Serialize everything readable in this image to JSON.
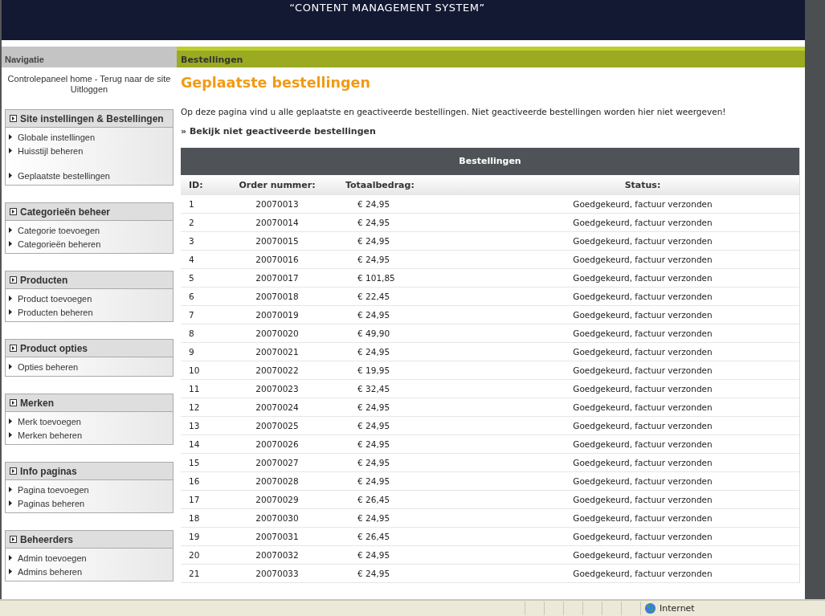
{
  "header": {
    "title": "“CONTENT MANAGEMENT SYSTEM”"
  },
  "sidebar": {
    "title": "Navigatie",
    "links": [
      "Controlepaneel home - Terug naar de site",
      "Uitloggen"
    ],
    "sections": [
      {
        "title": "Site instellingen & Bestellingen",
        "item_groups": [
          [
            "Globale instellingen",
            "Huisstijl beheren"
          ],
          [
            "Geplaatste bestellingen"
          ]
        ]
      },
      {
        "title": "Categorieën beheer",
        "item_groups": [
          [
            "Categorie toevoegen",
            "Categorieën beheren"
          ]
        ]
      },
      {
        "title": "Producten",
        "item_groups": [
          [
            "Product toevoegen",
            "Producten beheren"
          ]
        ]
      },
      {
        "title": "Product opties",
        "item_groups": [
          [
            "Opties beheren"
          ]
        ]
      },
      {
        "title": "Merken",
        "item_groups": [
          [
            "Merk toevoegen",
            "Merken beheren"
          ]
        ]
      },
      {
        "title": "Info paginas",
        "item_groups": [
          [
            "Pagina toevoegen",
            "Paginas beheren"
          ]
        ]
      },
      {
        "title": "Beheerders",
        "item_groups": [
          [
            "Admin toevoegen",
            "Admins beheren"
          ]
        ]
      }
    ]
  },
  "content": {
    "section_title": "Bestellingen",
    "heading": "Geplaatste bestellingen",
    "intro": "Op deze pagina vind u alle geplaatste en geactiveerde bestellingen. Niet geactiveerde bestellingen worden hier niet weergeven!",
    "link": "» Bekijk niet geactiveerde bestellingen",
    "table": {
      "caption": "Bestellingen",
      "columns": [
        "ID:",
        "Order nummer:",
        "Totaalbedrag:",
        "Status:"
      ],
      "rows": [
        [
          "1",
          "20070013",
          "€ 24,95",
          "Goedgekeurd, factuur verzonden"
        ],
        [
          "2",
          "20070014",
          "€ 24,95",
          "Goedgekeurd, factuur verzonden"
        ],
        [
          "3",
          "20070015",
          "€ 24,95",
          "Goedgekeurd, factuur verzonden"
        ],
        [
          "4",
          "20070016",
          "€ 24,95",
          "Goedgekeurd, factuur verzonden"
        ],
        [
          "5",
          "20070017",
          "€ 101,85",
          "Goedgekeurd, factuur verzonden"
        ],
        [
          "6",
          "20070018",
          "€ 22,45",
          "Goedgekeurd, factuur verzonden"
        ],
        [
          "7",
          "20070019",
          "€ 24,95",
          "Goedgekeurd, factuur verzonden"
        ],
        [
          "8",
          "20070020",
          "€ 49,90",
          "Goedgekeurd, factuur verzonden"
        ],
        [
          "9",
          "20070021",
          "€ 24,95",
          "Goedgekeurd, factuur verzonden"
        ],
        [
          "10",
          "20070022",
          "€ 19,95",
          "Goedgekeurd, factuur verzonden"
        ],
        [
          "11",
          "20070023",
          "€ 32,45",
          "Goedgekeurd, factuur verzonden"
        ],
        [
          "12",
          "20070024",
          "€ 24,95",
          "Goedgekeurd, factuur verzonden"
        ],
        [
          "13",
          "20070025",
          "€ 24,95",
          "Goedgekeurd, factuur verzonden"
        ],
        [
          "14",
          "20070026",
          "€ 24,95",
          "Goedgekeurd, factuur verzonden"
        ],
        [
          "15",
          "20070027",
          "€ 24,95",
          "Goedgekeurd, factuur verzonden"
        ],
        [
          "16",
          "20070028",
          "€ 24,95",
          "Goedgekeurd, factuur verzonden"
        ],
        [
          "17",
          "20070029",
          "€ 26,45",
          "Goedgekeurd, factuur verzonden"
        ],
        [
          "18",
          "20070030",
          "€ 24,95",
          "Goedgekeurd, factuur verzonden"
        ],
        [
          "19",
          "20070031",
          "€ 26,45",
          "Goedgekeurd, factuur verzonden"
        ],
        [
          "20",
          "20070032",
          "€ 24,95",
          "Goedgekeurd, factuur verzonden"
        ],
        [
          "21",
          "20070033",
          "€ 24,95",
          "Goedgekeurd, factuur verzonden"
        ]
      ]
    }
  },
  "status_bar": {
    "zone": "Internet"
  }
}
